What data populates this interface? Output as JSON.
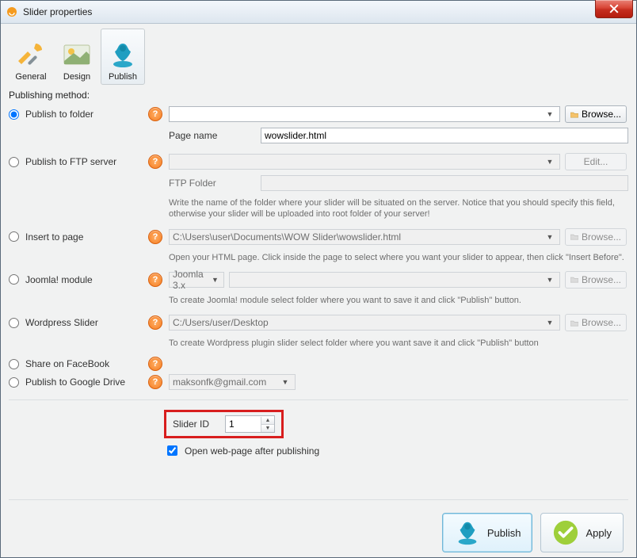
{
  "window": {
    "title": "Slider properties"
  },
  "tabs": {
    "general": "General",
    "design": "Design",
    "publish": "Publish"
  },
  "section_title": "Publishing method:",
  "methods": {
    "folder": {
      "label": "Publish to folder",
      "path": "",
      "page_name_label": "Page name",
      "page_name_value": "wowslider.html",
      "browse": "Browse..."
    },
    "ftp": {
      "label": "Publish to FTP server",
      "path": "",
      "folder_label": "FTP Folder",
      "folder_value": "",
      "hint": "Write the name of the folder where your slider will be situated on the server. Notice that you should specify this field, otherwise your slider will be uploaded into root folder of your server!",
      "edit": "Edit..."
    },
    "insert": {
      "label": "Insert to page",
      "path": "C:\\Users\\user\\Documents\\WOW Slider\\wowslider.html",
      "hint": "Open your HTML page. Click inside the page to select where you want your slider to appear, then click \"Insert Before\".",
      "browse": "Browse..."
    },
    "joomla": {
      "label": "Joomla! module",
      "version": "Joomla 3.x",
      "path": "",
      "hint": "To create Joomla! module select folder where you want to save it and click \"Publish\" button.",
      "browse": "Browse..."
    },
    "wp": {
      "label": "Wordpress Slider",
      "path": "C:/Users/user/Desktop",
      "hint": "To create Wordpress plugin slider select folder where you want save it and click \"Publish\" button",
      "browse": "Browse..."
    },
    "fb": {
      "label": "Share on FaceBook"
    },
    "gdrive": {
      "label": "Publish to Google Drive",
      "account": "maksonfk@gmail.com"
    }
  },
  "slider_id": {
    "label": "Slider ID",
    "value": "1"
  },
  "open_after": {
    "label": "Open web-page after publishing",
    "checked": true
  },
  "buttons": {
    "publish": "Publish",
    "apply": "Apply"
  }
}
